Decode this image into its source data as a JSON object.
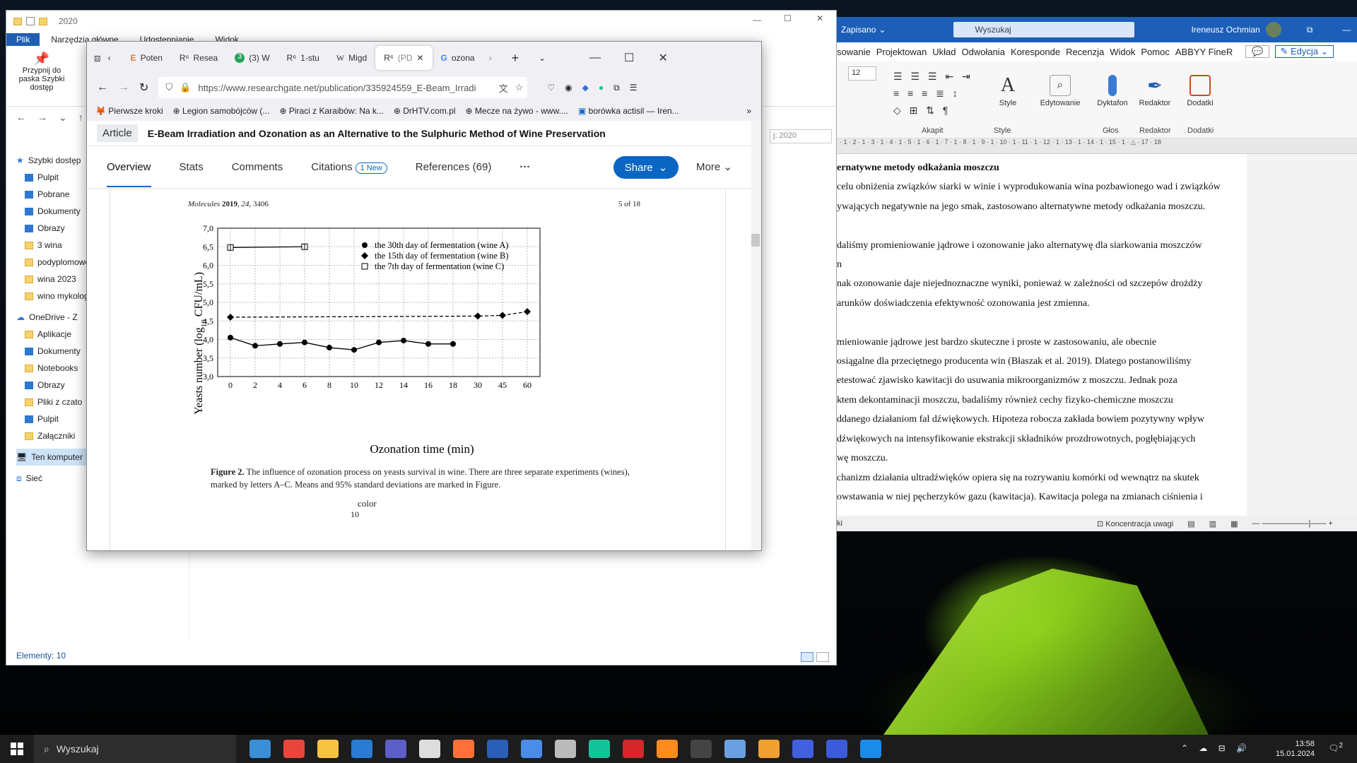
{
  "explorer": {
    "title": "2020",
    "ribbon_tabs": [
      "Plik",
      "Narzędzia główne",
      "Udostępnianie",
      "Widok"
    ],
    "pin_label": "Przypnij do paska Szybki dostęp",
    "search_placeholder": "j: 2020",
    "sidebar": [
      {
        "label": "Szybki dostęp",
        "type": "star"
      },
      {
        "label": "Pulpit",
        "type": "blue"
      },
      {
        "label": "Pobrane",
        "type": "blue"
      },
      {
        "label": "Dokumenty",
        "type": "blue"
      },
      {
        "label": "Obrazy",
        "type": "blue"
      },
      {
        "label": "3 wina",
        "type": "folder"
      },
      {
        "label": "podyplomowe",
        "type": "folder"
      },
      {
        "label": "wina 2023",
        "type": "folder"
      },
      {
        "label": "wino mykolog",
        "type": "folder"
      },
      {
        "label": "OneDrive - Z",
        "type": "cloud"
      },
      {
        "label": "Aplikacje",
        "type": "folder"
      },
      {
        "label": "Dokumenty",
        "type": "blue"
      },
      {
        "label": "Notebooks",
        "type": "folder"
      },
      {
        "label": "Obrazy",
        "type": "blue"
      },
      {
        "label": "Pliki z czato",
        "type": "folder"
      },
      {
        "label": "Pulpit",
        "type": "blue"
      },
      {
        "label": "Załączniki",
        "type": "folder"
      },
      {
        "label": "Ten komputer",
        "type": "pc"
      },
      {
        "label": "Sieć",
        "type": "net"
      }
    ],
    "status": "Elementy: 10"
  },
  "word": {
    "saved_label": "Zapisano",
    "search_placeholder": "Wyszukaj",
    "user": "Ireneusz Ochmian",
    "menu": [
      "sowanie",
      "Projektowan",
      "Układ",
      "Odwołania",
      "Koresponde",
      "Recenzja",
      "Widok",
      "Pomoc",
      "ABBYY FineR"
    ],
    "edit_mode": "Edycja",
    "font_size": "12",
    "groups": {
      "akapit": "Akapit",
      "style": "Style",
      "glos": "Głos",
      "redaktor": "Redaktor",
      "dodatki": "Dodatki"
    },
    "buttons": {
      "style": "Style",
      "edytowanie": "Edytowanie",
      "dyktafon": "Dyktafon",
      "redaktor": "Redaktor",
      "dodatki": "Dodatki"
    },
    "ruler": "· 1 · 2 · 1 · 3 · 1 · 4 · 1 · 5 · 1 · 6 · 1 · 7 · 1 · 8 · 1 · 9 · 1 · 10 · 1 · 11 · 1 · 12 · 1 · 13 · 1 · 14 · 1 · 15 · 1 · △ · 17 · 18",
    "doc_lines": [
      "ernatywne metody odkażania moszczu",
      "celu obniżenia związków siarki w winie i wyprodukowania wina pozbawionego wad i związków",
      "ywających negatywnie na jego smak, zastosowano alternatywne metody odkażania moszczu.",
      "",
      "daliśmy promieniowanie jądrowe i ozonowanie jako alternatywę dla siarkowania moszczów",
      "n",
      "nak ozonowanie daje niejednoznaczne wyniki, ponieważ w zależności od szczepów drożdży",
      "arunków doświadczenia efektywność ozonowania jest zmienna.",
      "",
      "mieniowanie jądrowe jest bardzo skuteczne i proste w zastosowaniu, ale obecnie",
      "osiągalne dla przeciętnego producenta win (Błaszak et al. 2019). Dlatego postanowiliśmy",
      "etestować zjawisko kawitacji do usuwania mikroorganizmów z moszczu. Jednak poza",
      "ktem dekontaminacji moszczu, badaliśmy również cechy fizyko-chemiczne moszczu",
      "ddanego działaniom fal dźwiękowych. Hipoteza robocza zakłada bowiem pozytywny wpływ",
      "dźwiękowych na intensyfikowanie ekstrakcji składników prozdrowotnych, pogłębiających",
      "wę moszczu.",
      "chanizm działania ultradźwięków opiera się na rozrywaniu komórki od wewnątrz na skutek",
      "owstawania w niej pęcherzyków gazu (kawitacja). Kawitacja polega na zmianach ciśnienia i"
    ],
    "status_left": "ki",
    "focus_label": "Koncentracja uwagi"
  },
  "browser": {
    "tabs": [
      {
        "icon": "E",
        "label": "Poten"
      },
      {
        "icon": "R⁶",
        "label": "Resea"
      },
      {
        "icon": "3",
        "label": "(3) W"
      },
      {
        "icon": "R⁶",
        "label": "1-stu"
      },
      {
        "icon": "W",
        "label": "Migd"
      },
      {
        "icon": "R⁶",
        "label": "(PD"
      },
      {
        "icon": "G",
        "label": "ozona"
      }
    ],
    "url": "https://www.researchgate.net/publication/335924559_E-Beam_Irradi",
    "bookmarks": [
      "Pierwsze kroki",
      "Legion samobójców (...",
      "Piraci z Karaibów: Na k...",
      "DrHTV.com.pl",
      "Mecze na żywo - www....",
      "borówka actisil — Iren..."
    ],
    "article_badge": "Article",
    "article_title": "E-Beam Irradiation and Ozonation as an Alternative to the Sulphuric Method of Wine Preservation",
    "rg_tabs": {
      "overview": "Overview",
      "stats": "Stats",
      "comments": "Comments",
      "citations": "Citations",
      "citations_new": "1 New",
      "references": "References (69)",
      "dots": "···",
      "share": "Share",
      "more": "More"
    },
    "pdf": {
      "journal": "Molecules",
      "year": "2019",
      "volume": "24",
      "pages": "3406",
      "page_of": "5 of 18",
      "caption_bold": "Figure 2.",
      "caption_text": "The influence of ozonation process on yeasts survival in wine. There are three separate experiments (wines), marked by letters A–C. Means and 95% standard deviations are marked in Figure.",
      "next_figure_label": "color",
      "next_figure_value": "10"
    }
  },
  "chart_data": {
    "type": "line",
    "categories": [
      "0",
      "2",
      "4",
      "6",
      "8",
      "10",
      "12",
      "14",
      "16",
      "18",
      "30",
      "45",
      "60"
    ],
    "series": [
      {
        "name": "the 30th day of fermentation (wine A)",
        "values": [
          4.05,
          3.83,
          3.88,
          3.92,
          3.78,
          3.72,
          3.92,
          3.97,
          3.88,
          3.88,
          null,
          null,
          null
        ]
      },
      {
        "name": "the 15th day of fermentation (wine B)",
        "values": [
          4.6,
          null,
          null,
          null,
          null,
          null,
          null,
          null,
          null,
          null,
          4.63,
          4.65,
          4.75
        ]
      },
      {
        "name": "the 7th day of fermentation (wine C)",
        "values": [
          6.48,
          null,
          null,
          6.5,
          null,
          null,
          null,
          null,
          null,
          null,
          null,
          null,
          null
        ]
      }
    ],
    "y_ticks": [
      "3,0",
      "3,5",
      "4,0",
      "4,5",
      "5,0",
      "5,5",
      "6,0",
      "6,5",
      "7,0"
    ],
    "ylim": [
      3.0,
      7.0
    ],
    "xlabel": "Ozonation time (min)",
    "ylabel_main": "Yeasts number (log",
    "ylabel_sub": "10",
    "ylabel_end": " CFU/mL)",
    "grid": true,
    "legend": "top-right"
  },
  "taskbar": {
    "search_placeholder": "Wyszukaj",
    "time": "13:58",
    "date": "15.01.2024",
    "notif_count": "2"
  }
}
